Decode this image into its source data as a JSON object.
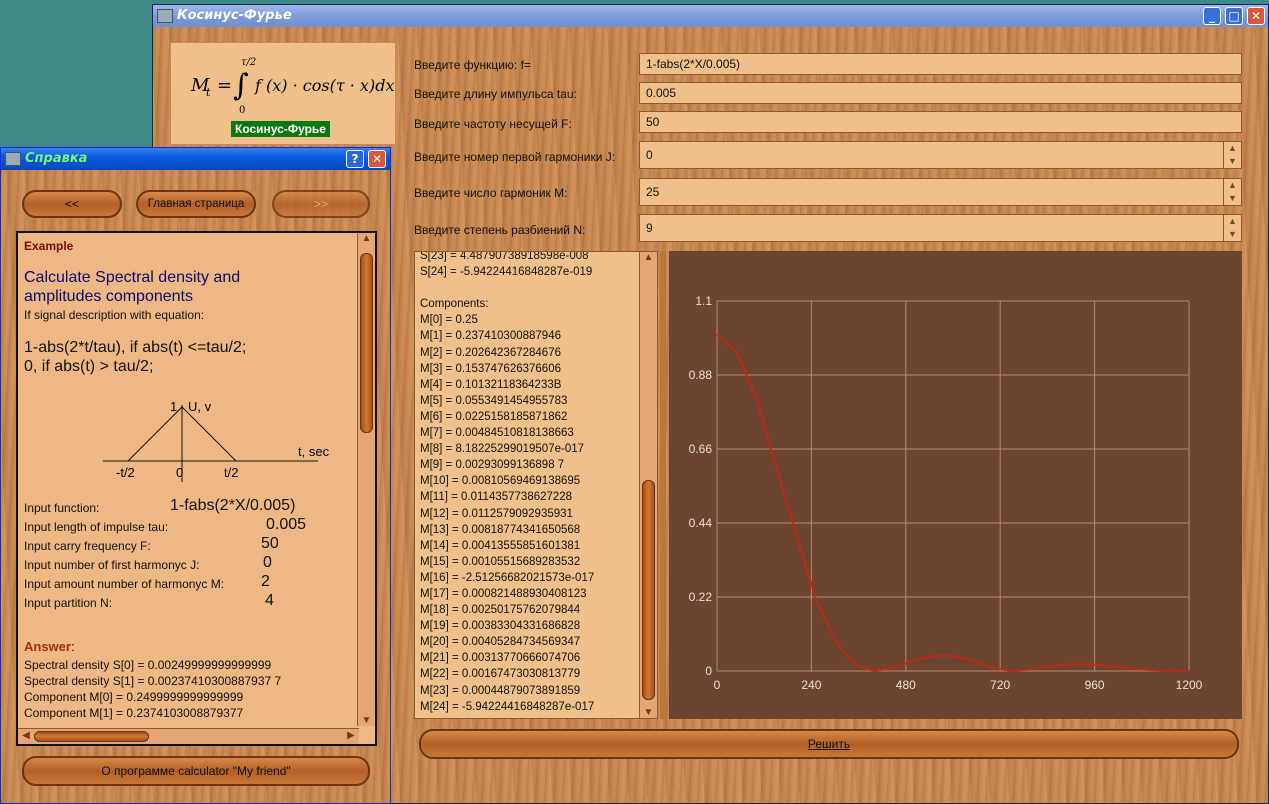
{
  "main_window": {
    "title": "Косинус-Фурье",
    "formula_badge": "Косинус-Фурье",
    "fields": [
      {
        "label": "Введите функцию: f=",
        "value": "1-fabs(2*X/0.005)"
      },
      {
        "label": "Введите длину импульса tau:",
        "value": "0.005"
      },
      {
        "label": "Введите частоту несущей F:",
        "value": "50"
      },
      {
        "label": "Введите номер первой гармоники J:",
        "value": "0"
      },
      {
        "label": "Введите число гармоник M:",
        "value": "25"
      },
      {
        "label": "Введите степень разбиений N:",
        "value": "9"
      }
    ],
    "results": [
      "S[23] = 4.48790738918598e-008",
      "S[24] = -5.94224416848287e-019",
      "",
      "Components:",
      "M[0] = 0.25",
      "M[1] = 0.237410300887946",
      "M[2] = 0.202642367284676",
      "M[3] = 0.153747626376606",
      "M[4] = 0.10132118364233B",
      "M[5] = 0.0553491454955783",
      "M[6] = 0.0225158185871862",
      "M[7] = 0.00484510818138663",
      "M[8] = 8.18225299019507e-017",
      "M[9] = 0.00293099136898 7",
      "M[10] = 0.00810569469138695",
      "M[11] = 0.0114357738627228",
      "M[12] = 0.0112579092935931",
      "M[13] = 0.00818774341650568",
      "M[14] = 0.00413555851601381",
      "M[15] = 0.00105515689283532",
      "M[16] = -2.51256682021573e-017",
      "M[17] = 0.000821488930408123",
      "M[18] = 0.00250175762079844",
      "M[19] = 0.00383304331686828",
      "M[20] = 0.00405284734569347",
      "M[21] = 0.00313770666074706",
      "M[22] = 0.00167473030813779",
      "M[23] = 0.00044879073891859",
      "M[24] = -5.94224416848287e-017"
    ],
    "solve_button": "Решить"
  },
  "help_window": {
    "title": "Справка",
    "back_button": "<<",
    "home_button": "Главная страница",
    "forward_button": ">>",
    "example_heading": "Example",
    "main_heading_1": "Calculate Spectral density and",
    "main_heading_2": "amplitudes components",
    "subheading": "If signal description with equation:",
    "equation_1": "1-abs(2*t/tau), if abs(t) <=tau/2;",
    "equation_2": "0, if abs(t) > tau/2;",
    "graph_labels": {
      "one": "1",
      "u": "U, v",
      "neg": "-t/2",
      "zero": "0",
      "pos": "t/2",
      "t": "t, sec"
    },
    "inputs": [
      {
        "label": "Input function:",
        "value": "1-fabs(2*X/0.005)"
      },
      {
        "label": "Input length of impulse tau:",
        "value": "0.005"
      },
      {
        "label": "Input carry frequency F:",
        "value": "50"
      },
      {
        "label": "Input number of first harmonyc J:",
        "value": "0"
      },
      {
        "label": "Input amount number of harmonyc M:",
        "value": "2"
      },
      {
        "label": "Input partition N:",
        "value": "4"
      }
    ],
    "answer_heading": "Answer",
    "answer_colon": ":",
    "answers": [
      "Spectral density S[0] = 0.00249999999999999",
      "Spectral density S[1] = 0.00237410300887937 7",
      "Component M[0] = 0.2499999999999999",
      "Component M[1] = 0.2374103008879377"
    ],
    "about_button": "О программе calculator \"My friend\""
  },
  "chart_data": {
    "type": "line",
    "title": "",
    "xlabel": "",
    "ylabel": "",
    "xlim": [
      0,
      1200
    ],
    "ylim": [
      0,
      1.1
    ],
    "x_ticks": [
      "0",
      "240",
      "480",
      "720",
      "960",
      "1200"
    ],
    "y_ticks": [
      "0",
      "0.22",
      "0.44",
      "0.66",
      "0.88",
      "1.1"
    ],
    "grid": true,
    "background": "#6b4530",
    "line_color": "#c0281a",
    "series": [
      {
        "x": [
          0,
          50,
          100,
          150,
          200,
          250,
          300,
          350,
          400,
          450,
          500,
          550,
          600,
          650,
          700,
          750,
          800,
          850,
          900,
          950,
          1000,
          1050,
          1100,
          1150,
          1200
        ],
        "y": [
          1.0,
          0.95,
          0.81,
          0.61,
          0.41,
          0.22,
          0.09,
          0.02,
          0.0,
          0.01,
          0.03,
          0.045,
          0.045,
          0.03,
          0.01,
          0.0,
          0.005,
          0.015,
          0.02,
          0.02,
          0.015,
          0.008,
          0.003,
          0.001,
          0.0
        ]
      }
    ]
  }
}
